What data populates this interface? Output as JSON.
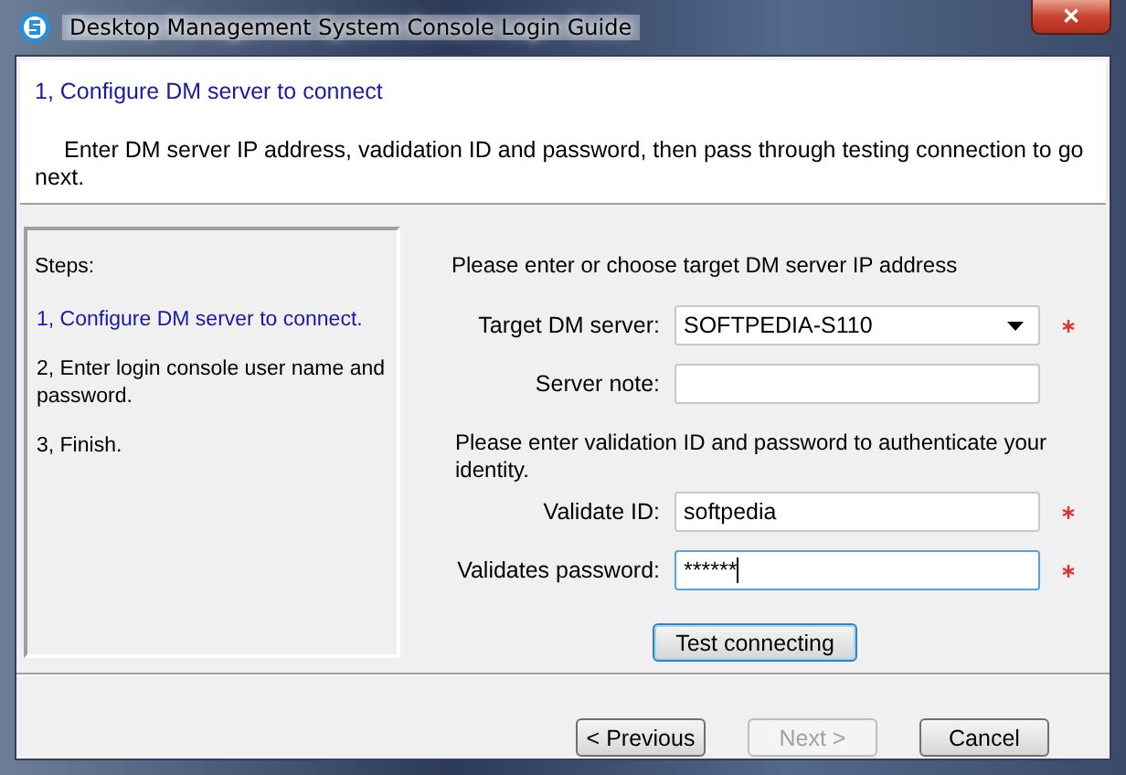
{
  "window": {
    "title": "Desktop Management System Console Login Guide",
    "close": "✕"
  },
  "header": {
    "title": "1, Configure DM server to connect",
    "description": "Enter DM server IP address, vadidation ID and password, then pass through testing connection to go next."
  },
  "steps": {
    "heading": "Steps:",
    "items": [
      {
        "label": "1, Configure DM server to connect.",
        "selected": true
      },
      {
        "label": "2, Enter login console user name and password.",
        "selected": false
      },
      {
        "label": "3, Finish.",
        "selected": false
      }
    ]
  },
  "form": {
    "rows": [
      {
        "kind": "prompt",
        "text": "Please enter or choose target DM server IP address"
      },
      {
        "kind": "dropdown",
        "label": "Target DM server:",
        "value": "SOFTPEDIA-S110",
        "required": true,
        "focused": false
      },
      {
        "kind": "text",
        "label": "Server note:",
        "value": "",
        "required": false,
        "focused": false
      },
      {
        "kind": "prompt",
        "text": "Please enter validation ID and password to authenticate your identity."
      },
      {
        "kind": "text",
        "label": "Validate ID:",
        "value": "softpedia",
        "required": true,
        "focused": false
      },
      {
        "kind": "text",
        "label": "Validates password:",
        "value": "******",
        "required": true,
        "focused": true
      }
    ],
    "test_button": "Test connecting"
  },
  "buttons": [
    {
      "label": "< Previous",
      "disabled": false
    },
    {
      "label": "Next >",
      "disabled": true
    },
    {
      "label": "Cancel",
      "disabled": false
    }
  ]
}
